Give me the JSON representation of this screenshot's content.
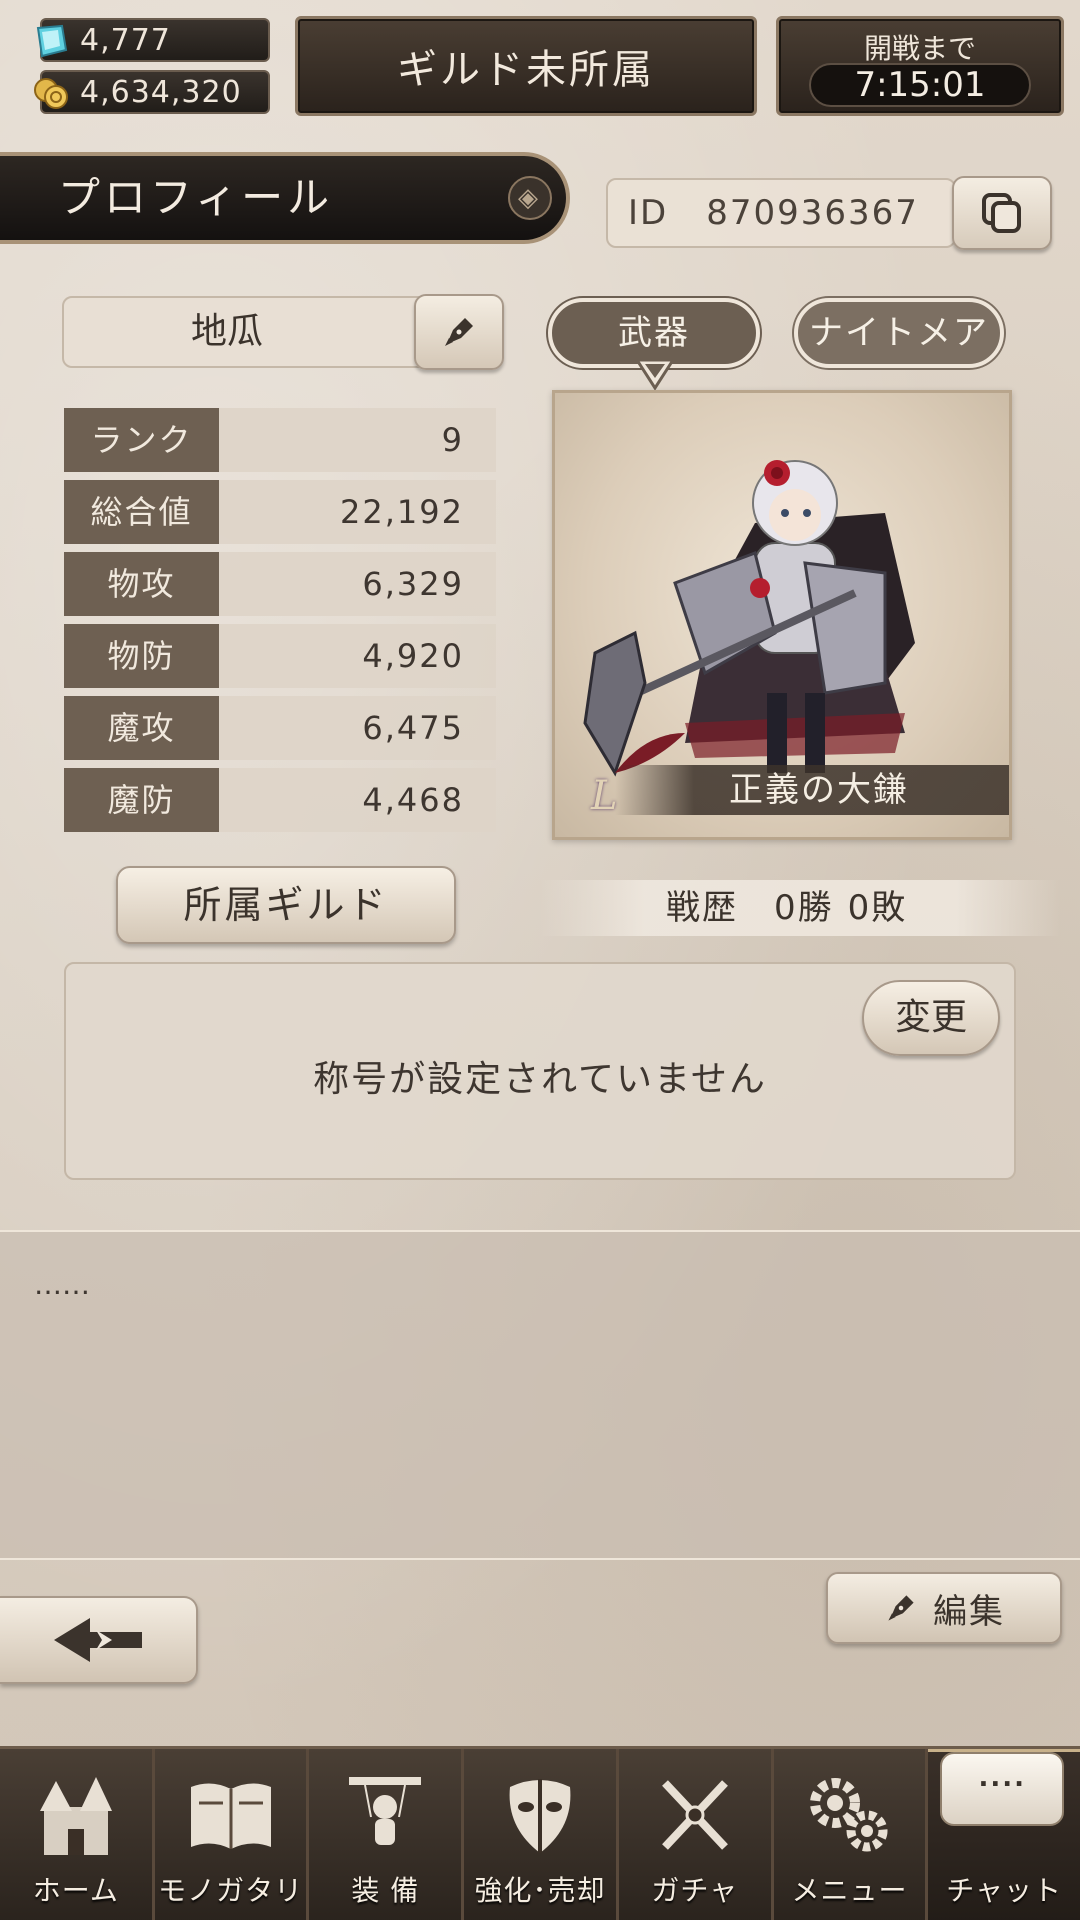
{
  "resources": {
    "gems": "4,777",
    "coins": "4,634,320"
  },
  "guild_banner": "ギルド未所属",
  "timer": {
    "label": "開戦まで",
    "value": "7:15:01"
  },
  "profile": {
    "title": "プロフィール",
    "id_label": "ID",
    "id_value": "870936367",
    "name": "地瓜"
  },
  "stats": [
    {
      "label": "ランク",
      "value": "9"
    },
    {
      "label": "総合値",
      "value": "22,192"
    },
    {
      "label": "物攻",
      "value": "6,329"
    },
    {
      "label": "物防",
      "value": "4,920"
    },
    {
      "label": "魔攻",
      "value": "6,475"
    },
    {
      "label": "魔防",
      "value": "4,468"
    }
  ],
  "tabs": {
    "weapon": "武器",
    "nightmare": "ナイトメア"
  },
  "weapon": {
    "name": "正義の大鎌",
    "rarity": "L"
  },
  "guild_button": "所属ギルド",
  "record": {
    "label": "戦歴",
    "wins": "0勝",
    "losses": "0敗"
  },
  "title_panel": {
    "message": "称号が設定されていません",
    "change_button": "変更"
  },
  "comment": "……",
  "edit_button": "編集",
  "nav": [
    {
      "label": "ホーム",
      "icon": "castle-icon"
    },
    {
      "label": "モノガタリ",
      "icon": "book-icon"
    },
    {
      "label": "装 備",
      "icon": "puppet-icon"
    },
    {
      "label": "強化･売却",
      "icon": "mask-icon"
    },
    {
      "label": "ガチャ",
      "icon": "swords-icon"
    },
    {
      "label": "メニュー",
      "icon": "gears-icon"
    },
    {
      "label": "チャット",
      "icon": "chat-bubble-icon",
      "bubble": "...."
    }
  ],
  "colors": {
    "background": "#d9cec1",
    "dark_panel": "#2a221c",
    "stat_label": "#6e6052",
    "accent_border": "#8a7762"
  }
}
